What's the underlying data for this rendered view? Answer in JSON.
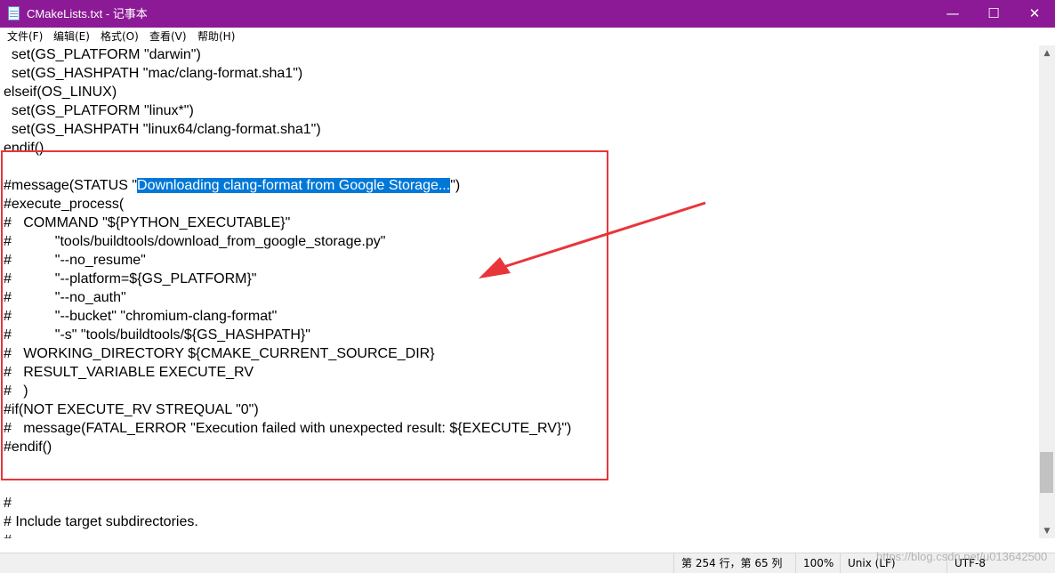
{
  "window": {
    "title": "CMakeLists.txt - 记事本",
    "icons": {
      "app": "notepad-icon",
      "minimize": "minimize-icon",
      "maximize": "maximize-icon",
      "close": "close-icon"
    },
    "controls": {
      "minimize": "—",
      "maximize": "☐",
      "close": "✕"
    },
    "title_bar_color": "#8c1a96"
  },
  "menu": {
    "items": [
      {
        "label": "文件(F)"
      },
      {
        "label": "编辑(E)"
      },
      {
        "label": "格式(O)"
      },
      {
        "label": "查看(V)"
      },
      {
        "label": "帮助(H)"
      }
    ]
  },
  "editor": {
    "lines": [
      "  set(GS_PLATFORM \"darwin\")",
      "  set(GS_HASHPATH \"mac/clang-format.sha1\")",
      "elseif(OS_LINUX)",
      "  set(GS_PLATFORM \"linux*\")",
      "  set(GS_HASHPATH \"linux64/clang-format.sha1\")",
      "endif()",
      "",
      "#message(STATUS \"Downloading clang-format from Google Storage...\")",
      "#execute_process(",
      "#   COMMAND \"${PYTHON_EXECUTABLE}\"",
      "#           \"tools/buildtools/download_from_google_storage.py\"",
      "#           \"--no_resume\"",
      "#           \"--platform=${GS_PLATFORM}\"",
      "#           \"--no_auth\"",
      "#           \"--bucket\" \"chromium-clang-format\"",
      "#           \"-s\" \"tools/buildtools/${GS_HASHPATH}\"",
      "#   WORKING_DIRECTORY ${CMAKE_CURRENT_SOURCE_DIR}",
      "#   RESULT_VARIABLE EXECUTE_RV",
      "#   )",
      "#if(NOT EXECUTE_RV STREQUAL \"0\")",
      "#   message(FATAL_ERROR \"Execution failed with unexpected result: ${EXECUTE_RV}\")",
      "#endif()",
      "",
      "",
      "#",
      "# Include target subdirectories.",
      "#"
    ],
    "selection": {
      "before": "#message(STATUS \"",
      "selected": "Downloading clang-format from Google Storage...",
      "after": "\")"
    },
    "selection_color": "#0078d7"
  },
  "annotation": {
    "box_color": "#e8353a",
    "arrow_color": "#e8353a"
  },
  "status": {
    "position": "第 254 行，第 65 列",
    "zoom": "100%",
    "line_ending": "Unix (LF)",
    "encoding": "UTF-8"
  },
  "watermark": "https://blog.csdn.net/u013642500"
}
